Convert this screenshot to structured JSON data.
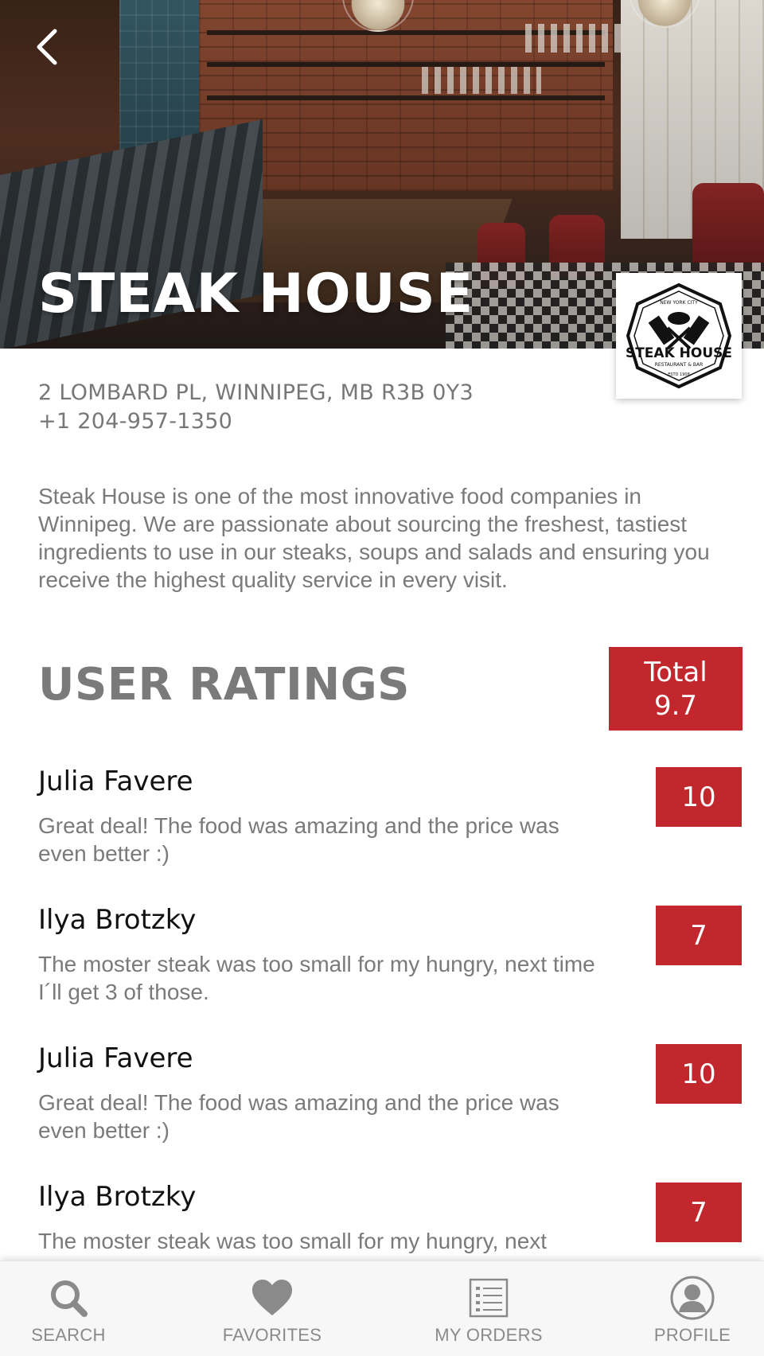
{
  "hero": {
    "title": "STEAK HOUSE",
    "back_icon": "chevron-left-icon"
  },
  "logo": {
    "top_text": "NEW YORK CITY",
    "name": "STEAK HOUSE",
    "subtitle": "RESTAURANT & BAR",
    "est": "ESTD 1908"
  },
  "info": {
    "address": "2 LOMBARD PL, WINNIPEG, MB R3B 0Y3",
    "phone": "+1 204-957-1350",
    "description": "Steak House is one of the most innovative food companies in Winnipeg. We are passionate about sourcing the freshest, tastiest ingredients to use in our steaks, soups and salads and ensuring you receive the highest quality service in every visit."
  },
  "ratings": {
    "title": "USER RATINGS",
    "total_label": "Total",
    "total_value": "9.7",
    "reviews": [
      {
        "name": "Julia Favere",
        "text": "Great deal! The food was amazing and the price was even better :)",
        "score": "10"
      },
      {
        "name": "Ilya Brotzky",
        "text": "The moster steak was too small for my hungry, next time I´ll get 3 of those.",
        "score": "7"
      },
      {
        "name": "Julia Favere",
        "text": "Great deal! The food was amazing and the price was even better :)",
        "score": "10"
      },
      {
        "name": "Ilya Brotzky",
        "text": "The moster steak was too small for my hungry, next",
        "score": "7"
      }
    ]
  },
  "tabbar": {
    "items": [
      {
        "label": "SEARCH",
        "icon": "search-icon"
      },
      {
        "label": "FAVORITES",
        "icon": "heart-icon"
      },
      {
        "label": "MY ORDERS",
        "icon": "list-icon"
      },
      {
        "label": "PROFILE",
        "icon": "user-icon"
      }
    ]
  },
  "colors": {
    "accent": "#c1272d",
    "text_gray": "#7a7a7a",
    "tab_gray": "#8a8a8a"
  }
}
